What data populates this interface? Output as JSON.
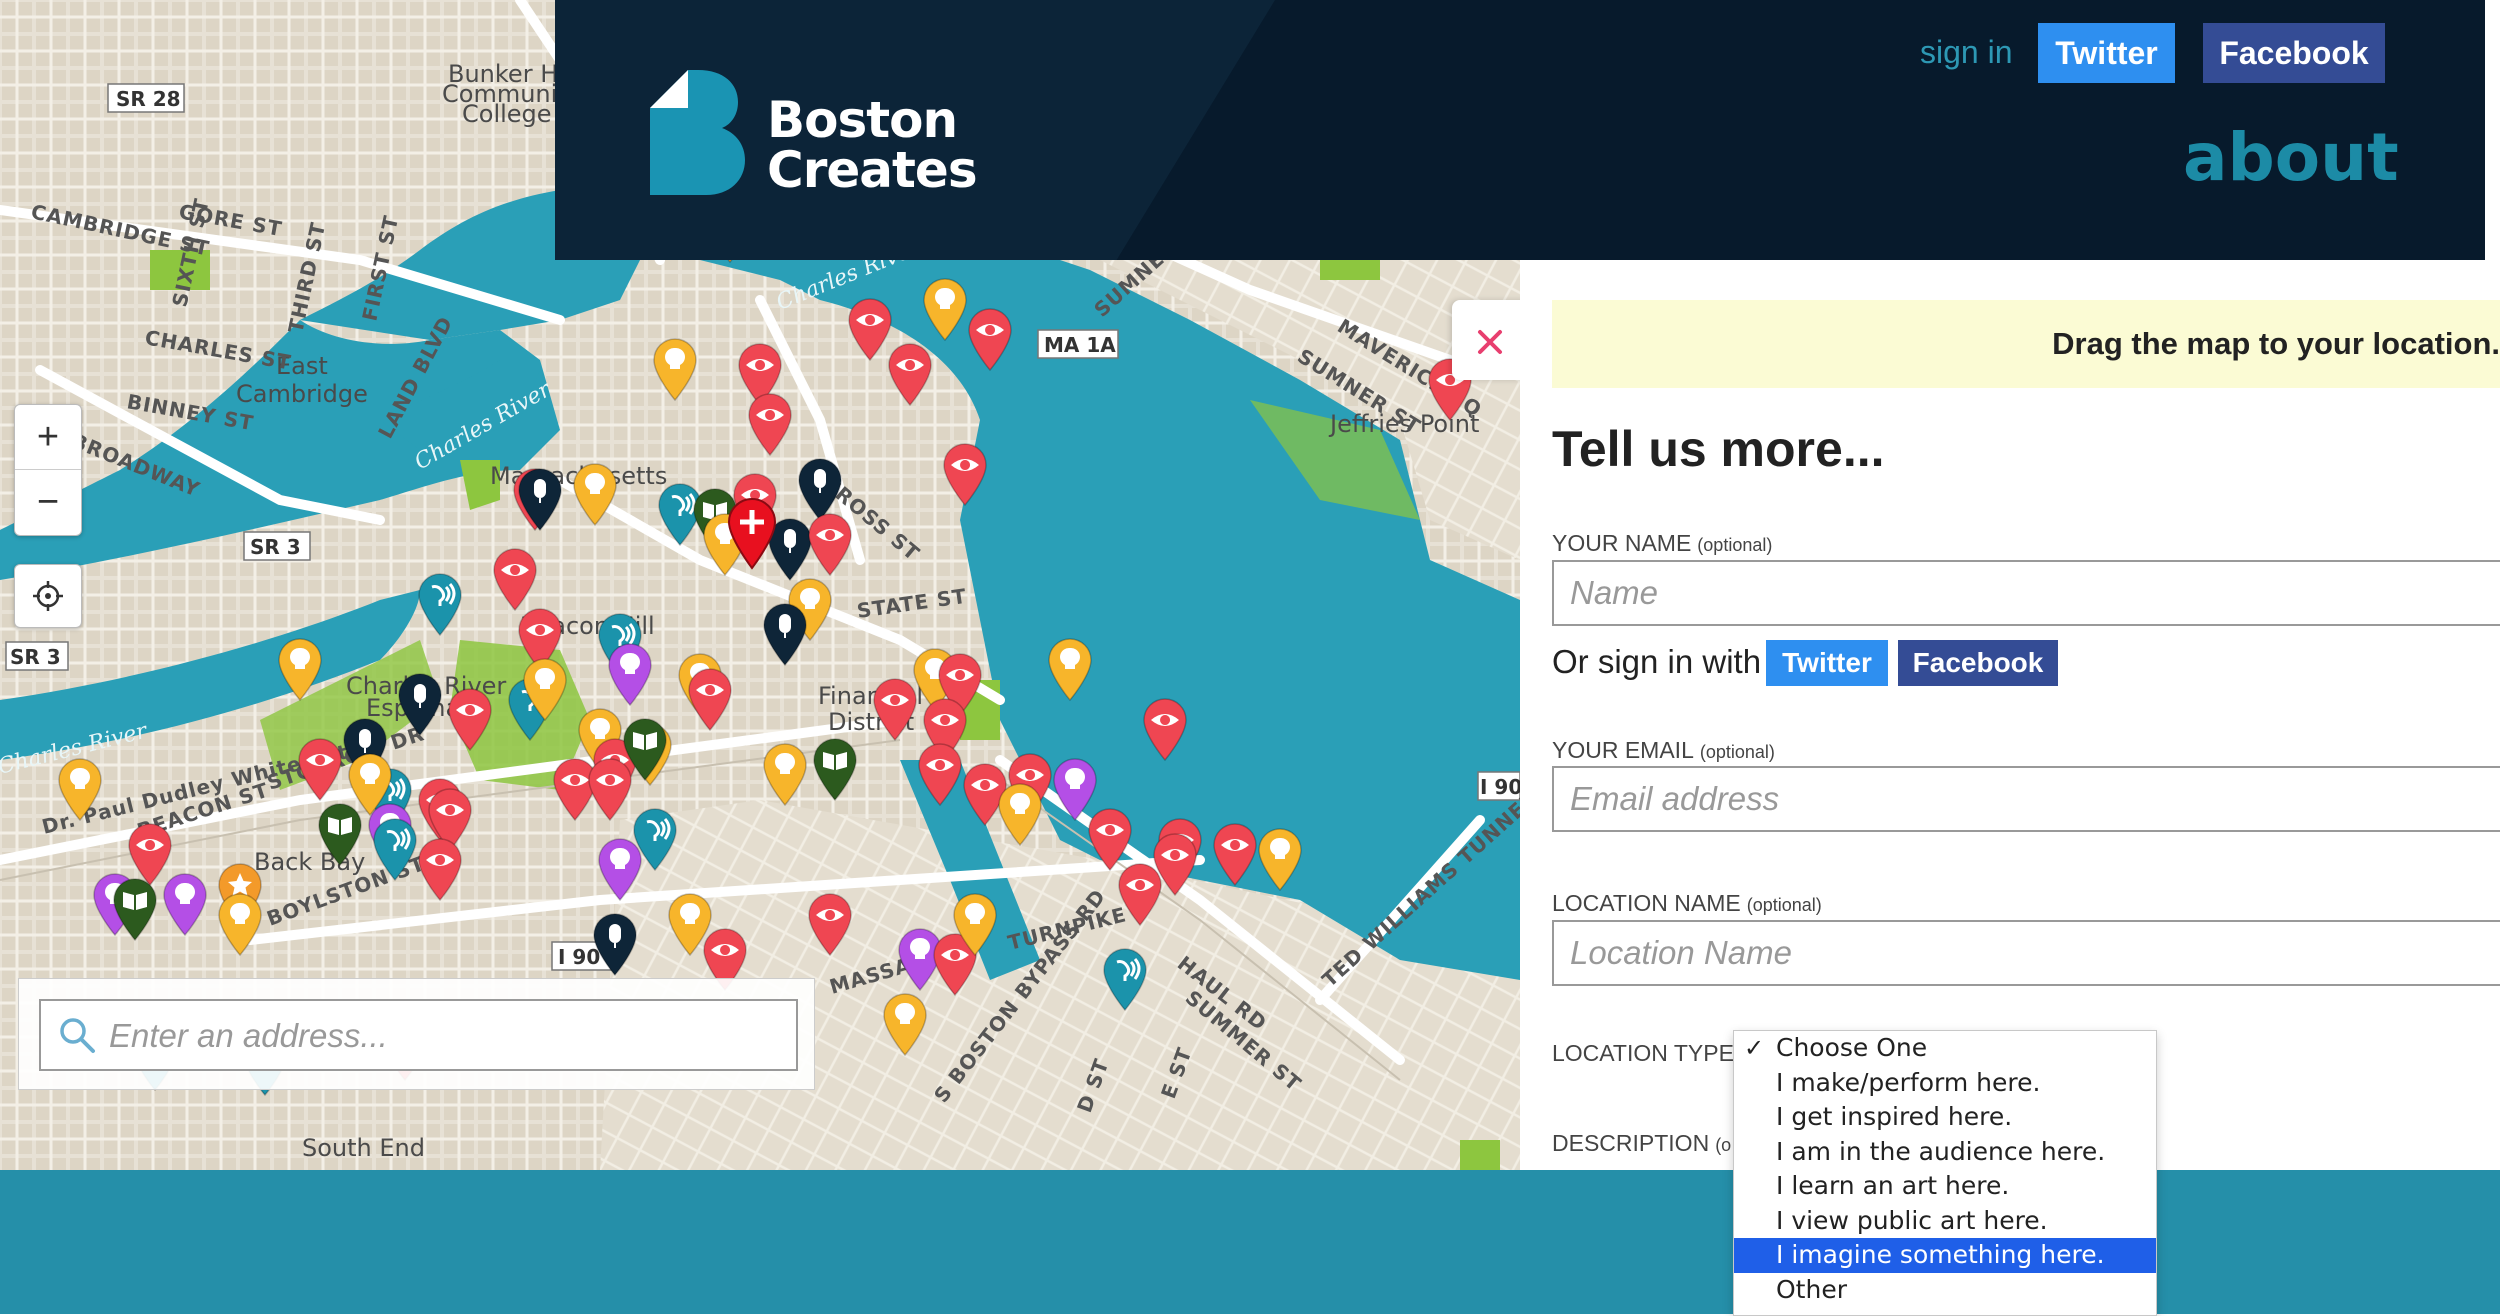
{
  "header": {
    "logo_line1": "Boston",
    "logo_line2": "Creates",
    "signin": "sign in",
    "twitter": "Twitter",
    "facebook": "Facebook",
    "about": "about"
  },
  "map": {
    "zoom_in": "+",
    "zoom_out": "−",
    "search_placeholder": "Enter an address...",
    "labels": {
      "sr28": "SR 28",
      "sr3_top": "SR 3",
      "sr3": "SR 3",
      "ma1a": "MA 1A",
      "i90": "I 90",
      "i90_2": "I 90",
      "bunker": "Bunker Hill",
      "community": "Community",
      "college": "College",
      "east": "East",
      "cambridge": "Cambridge",
      "mit1": "Massachusetts",
      "mit2": "...",
      "beacon_hill": "Beacon Hill",
      "charles_esplanade": "Charles River",
      "esplanade2": "Esplanade",
      "financial": "Financial",
      "district": "District",
      "back_bay": "Back Bay",
      "south_end": "South End",
      "jeffries": "Jeffries Point",
      "charles_river1": "Charles River",
      "charles_river2": "Charles River",
      "charles_river3": "Charles River",
      "gore": "GORE ST",
      "cambridge_st": "CAMBRIDGE ST",
      "charles_st": "CHARLES ST",
      "binney": "BINNEY ST",
      "broadway": "BROADWAY",
      "third": "THIRD ST",
      "sixth": "SIXTH ST",
      "first": "FIRST ST",
      "land": "LAND BLVD",
      "cross": "CROSS ST",
      "state": "STATE ST",
      "sumner1": "SUMNER ST",
      "sumner2": "SUMNER ST",
      "maverick": "MAVERICK SQ",
      "storrow": "STORROW DR",
      "beacon": "BEACON ST",
      "boylston": "BOYLSTON ST",
      "haul": "HAUL RD",
      "summer": "SUMMER ST",
      "ted": "TED WILLIAMS TUNNEL",
      "sboston": "S BOSTON BYPASS RD",
      "dst": "D ST",
      "est": "E ST",
      "dudley": "Dr. Paul Dudley White Path",
      "pike": "TURNPIKE",
      "mass": "MASSACH"
    }
  },
  "panel": {
    "close": "×",
    "notice": "Drag the map to your location.",
    "title": "Tell us more...",
    "name_label": "YOUR NAME",
    "optional": "(optional)",
    "name_placeholder": "Name",
    "or_signin": "Or sign in with",
    "twitter": "Twitter",
    "facebook": "Facebook",
    "email_label": "YOUR EMAIL",
    "email_placeholder": "Email address",
    "location_name_label": "LOCATION NAME",
    "location_name_placeholder": "Location Name",
    "location_type_label": "LOCATION TYPE",
    "description_label": "DESCRIPTION",
    "description_optional": "(o"
  },
  "dropdown": {
    "options": [
      "Choose One",
      "I make/perform here.",
      "I get inspired here.",
      "I am in the audience here.",
      "I learn an art here.",
      "I view public art here.",
      "I imagine something here.",
      "Other"
    ],
    "checked": "Choose One",
    "highlighted": "I imagine something here."
  },
  "colors": {
    "header_bg": "#071a2c",
    "accent": "#1c8ba6",
    "twitter": "#2e8ff0",
    "facebook": "#344c95",
    "water": "#2a9fb7",
    "pin_red": "#ef4652",
    "pin_yellow": "#f7b52b",
    "pin_teal": "#1b93ab",
    "pin_navy": "#0e2538",
    "pin_purple": "#b44fe6",
    "pin_green": "#2c5a1e",
    "pin_orange": "#f39a2a",
    "select_highlight": "#1f5fe8"
  }
}
